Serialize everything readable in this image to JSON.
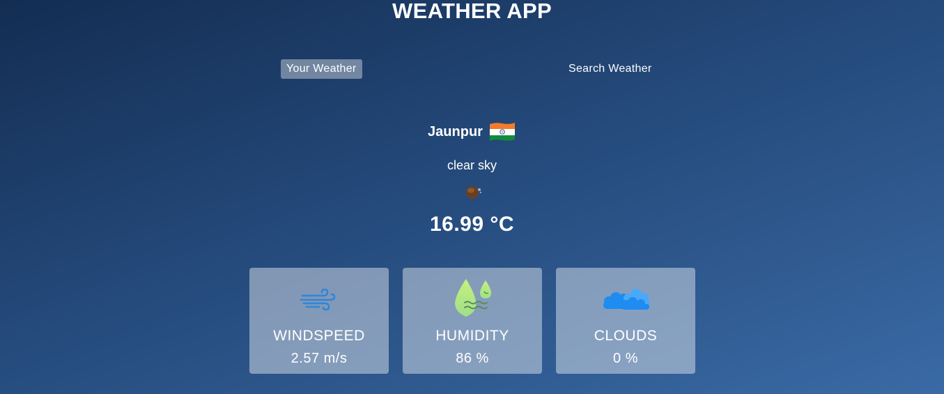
{
  "app": {
    "title": "WEATHER APP"
  },
  "tabs": [
    {
      "label": "Your Weather",
      "active": true
    },
    {
      "label": "Search Weather",
      "active": false
    }
  ],
  "weather": {
    "city": "Jaunpur",
    "country_flag_icon": "india-flag-icon",
    "description": "clear sky",
    "condition_icon": "clear-sky-night-icon",
    "temperature": "16.99 °C"
  },
  "stats": [
    {
      "title": "WINDSPEED",
      "value": "2.57 m/s",
      "icon": "wind-icon",
      "icon_color": "#2f86d9"
    },
    {
      "title": "HUMIDITY",
      "value": "86 %",
      "icon": "humidity-icon",
      "icon_color": "#b8ec7a"
    },
    {
      "title": "CLOUDS",
      "value": "0 %",
      "icon": "clouds-icon",
      "icon_color": "#1e8cf0"
    }
  ],
  "colors": {
    "background_start": "#132d52",
    "background_end": "#3a6aa5",
    "active_tab": "rgba(255,255,255,0.38)",
    "card": "rgba(255,255,255,0.42)"
  }
}
